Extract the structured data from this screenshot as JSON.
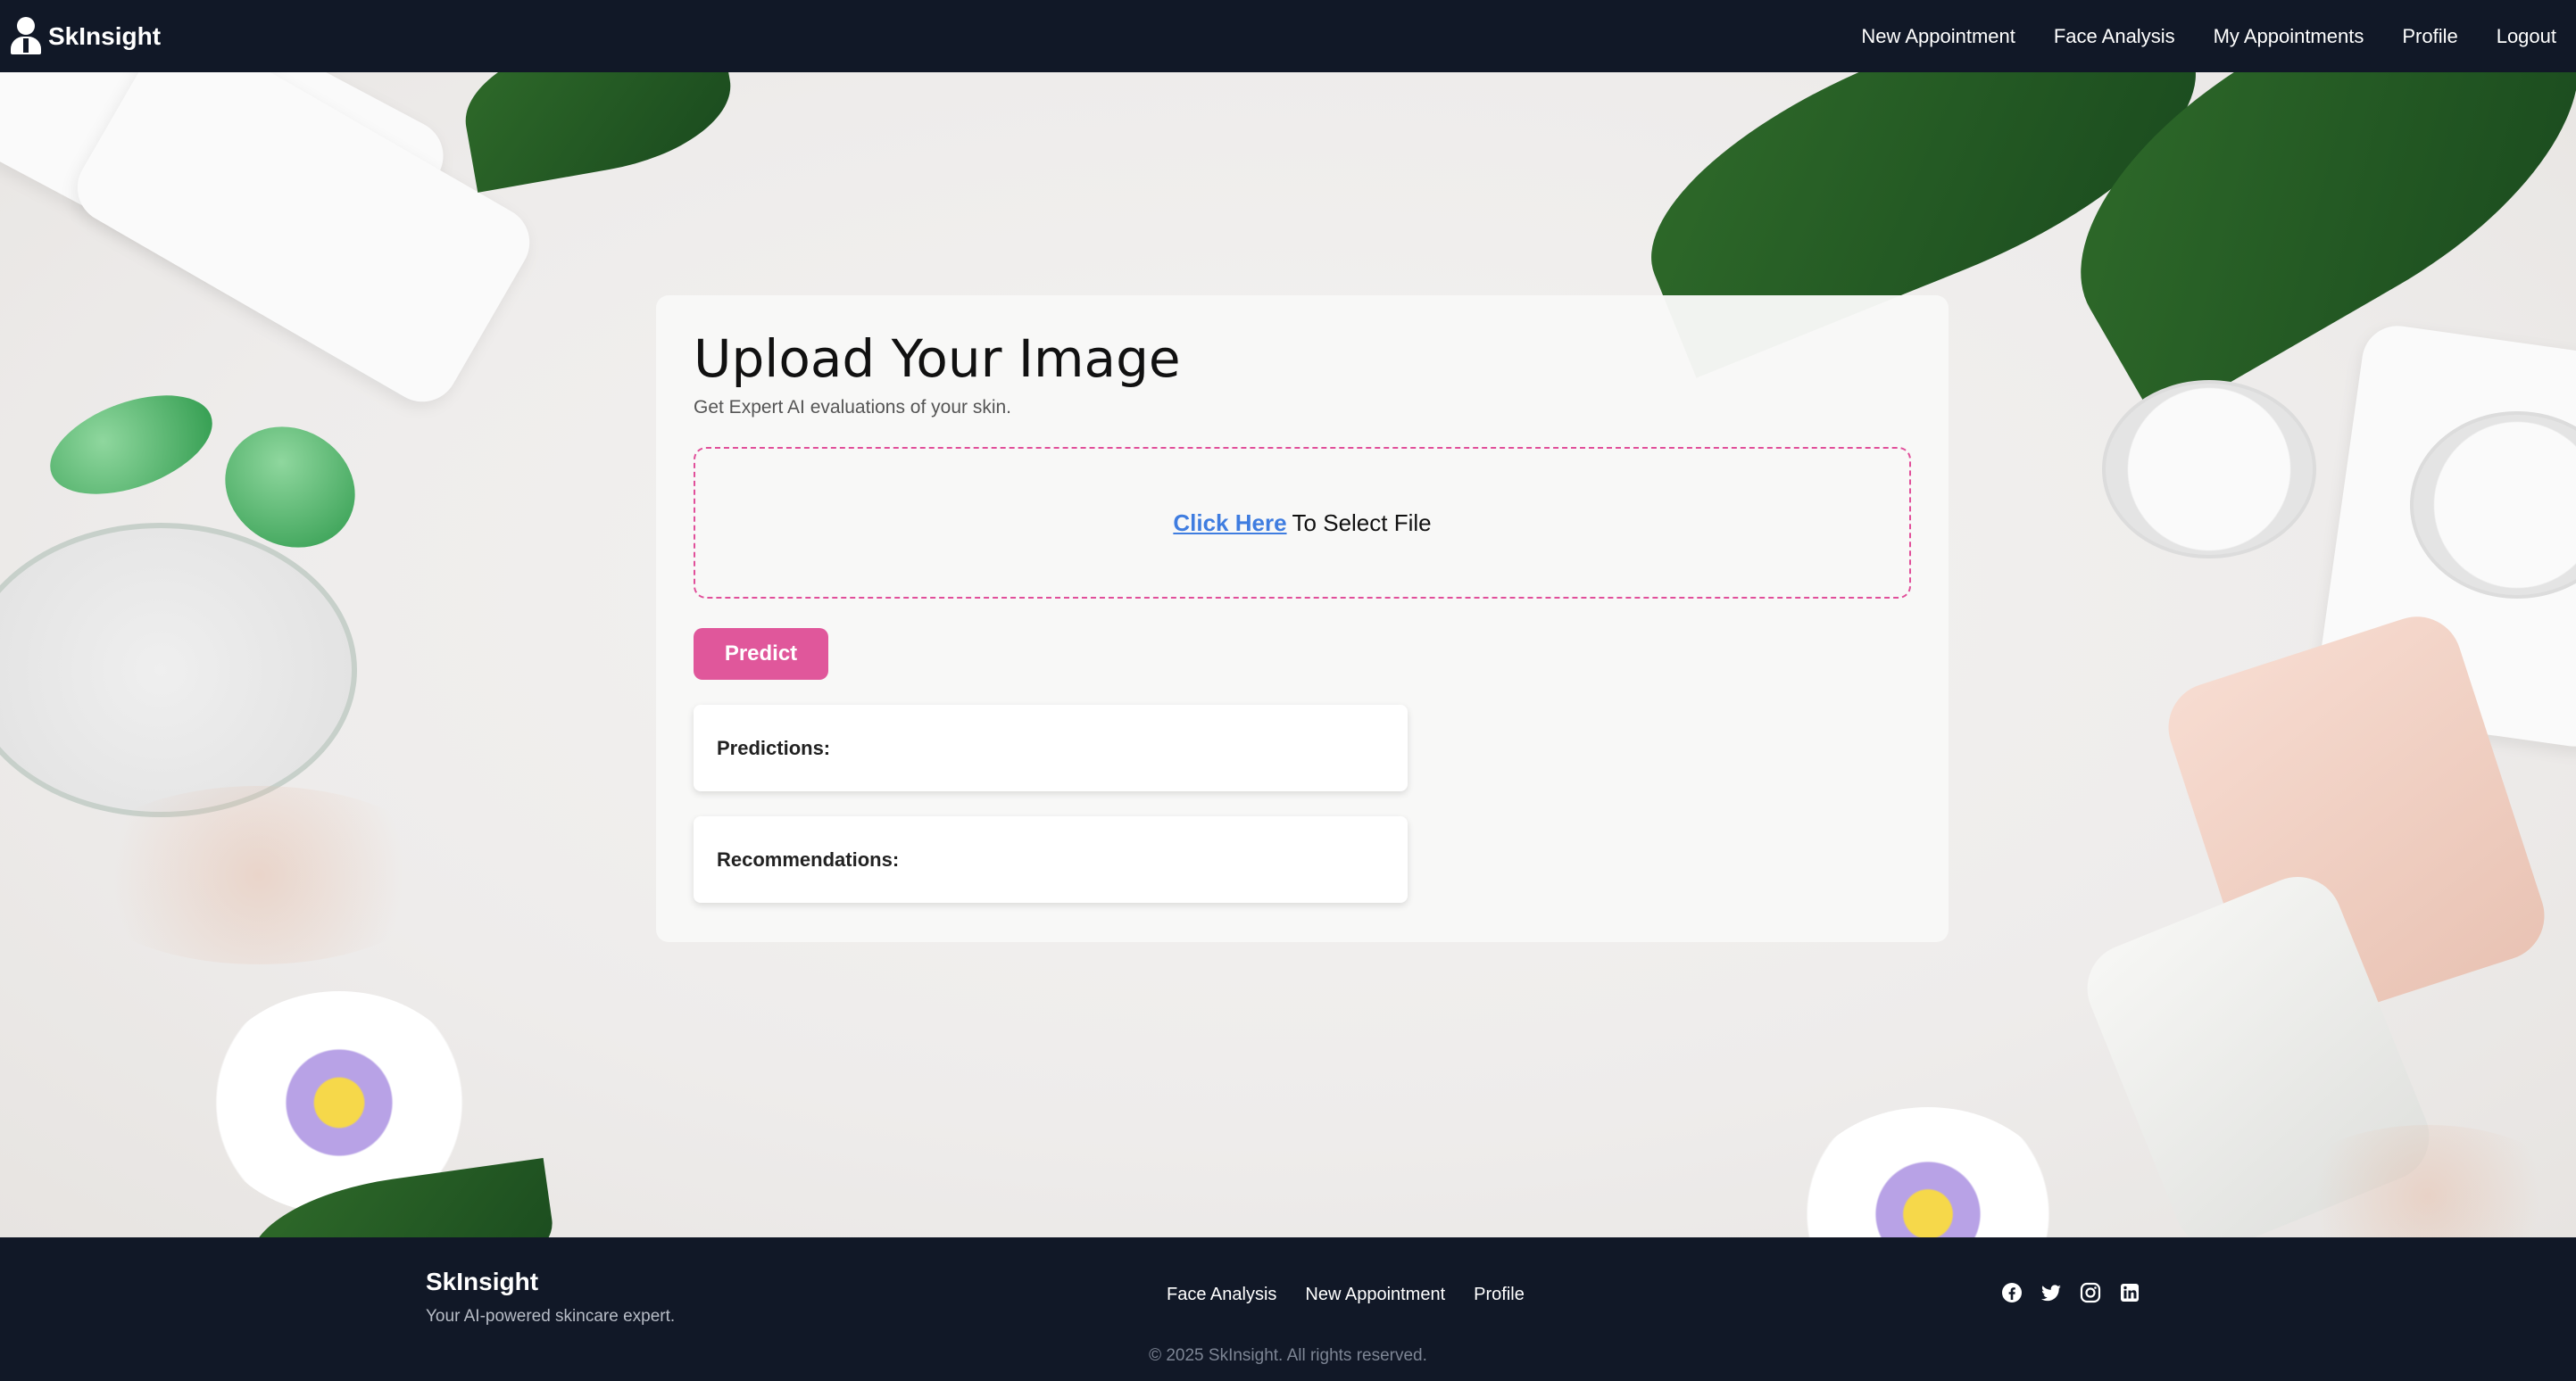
{
  "nav": {
    "brand": "SkInsight",
    "links": [
      "New Appointment",
      "Face Analysis",
      "My Appointments",
      "Profile",
      "Logout"
    ]
  },
  "card": {
    "title": "Upload Your Image",
    "subtitle": "Get Expert AI evaluations of your skin.",
    "dropzone_link": "Click Here",
    "dropzone_text": "To Select File",
    "predict_label": "Predict",
    "predictions_label": "Predictions:",
    "recommendations_label": "Recommendations:"
  },
  "footer": {
    "brand": "SkInsight",
    "tagline": "Your AI-powered skincare expert.",
    "links": [
      "Face Analysis",
      "New Appointment",
      "Profile"
    ],
    "socials": [
      "facebook-icon",
      "twitter-icon",
      "instagram-icon",
      "linkedin-icon"
    ],
    "copyright": "© 2025 SkInsight. All rights reserved."
  },
  "colors": {
    "nav_bg": "#111827",
    "accent_pink": "#e0579b",
    "link_blue": "#3f7de0"
  }
}
